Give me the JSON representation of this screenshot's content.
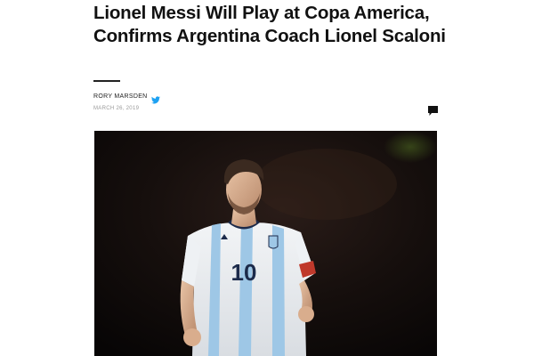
{
  "article": {
    "headline": "Lionel Messi Will Play at Copa America, Confirms Argentina Coach Lionel Scaloni",
    "author": "RORY MARSDEN",
    "date": "MARCH 26, 2019",
    "jersey_number": "10"
  },
  "icons": {
    "author_social": "twitter-icon",
    "comments": "comment-icon"
  },
  "colors": {
    "twitter": "#1da1f2",
    "headline": "#111111",
    "date": "#9a9a9a"
  }
}
